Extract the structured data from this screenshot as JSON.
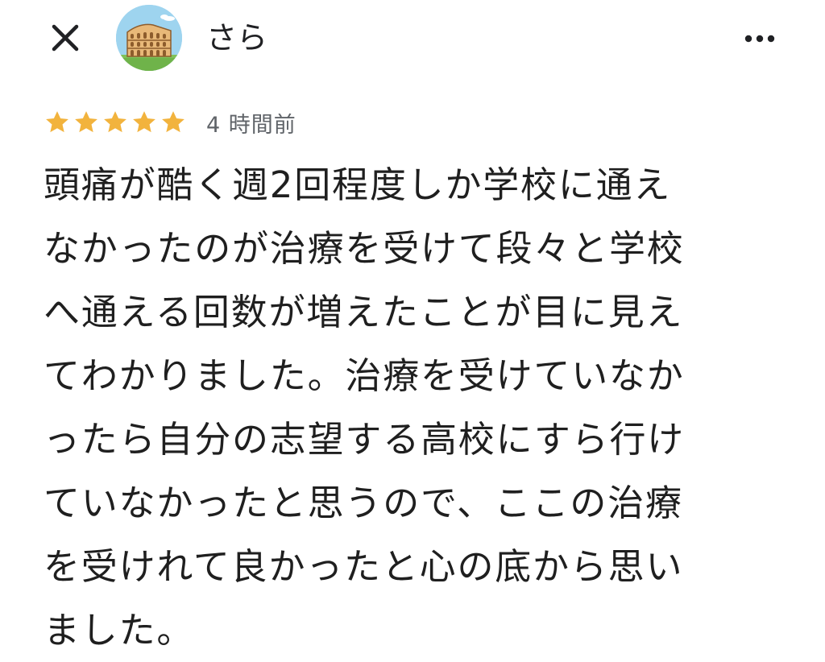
{
  "header": {
    "user_name": "さら",
    "avatar_icon": "colosseum-avatar-icon",
    "close_icon": "close-icon",
    "more_icon": "more-horizontal-icon"
  },
  "review": {
    "rating": 5,
    "rating_max": 5,
    "star_color": "#f2b33d",
    "time_ago": "4 時間前",
    "text": "頭痛が酷く週2回程度しか学校に通え\nなかったのが治療を受けて段々と学校\nへ通える回数が増えたことが目に見え\nてわかりました。治療を受けていなか\nったら自分の志望する高校にすら行け\nていなかったと思うので、ここの治療\nを受けれて良かったと心の底から思い\nました。"
  }
}
